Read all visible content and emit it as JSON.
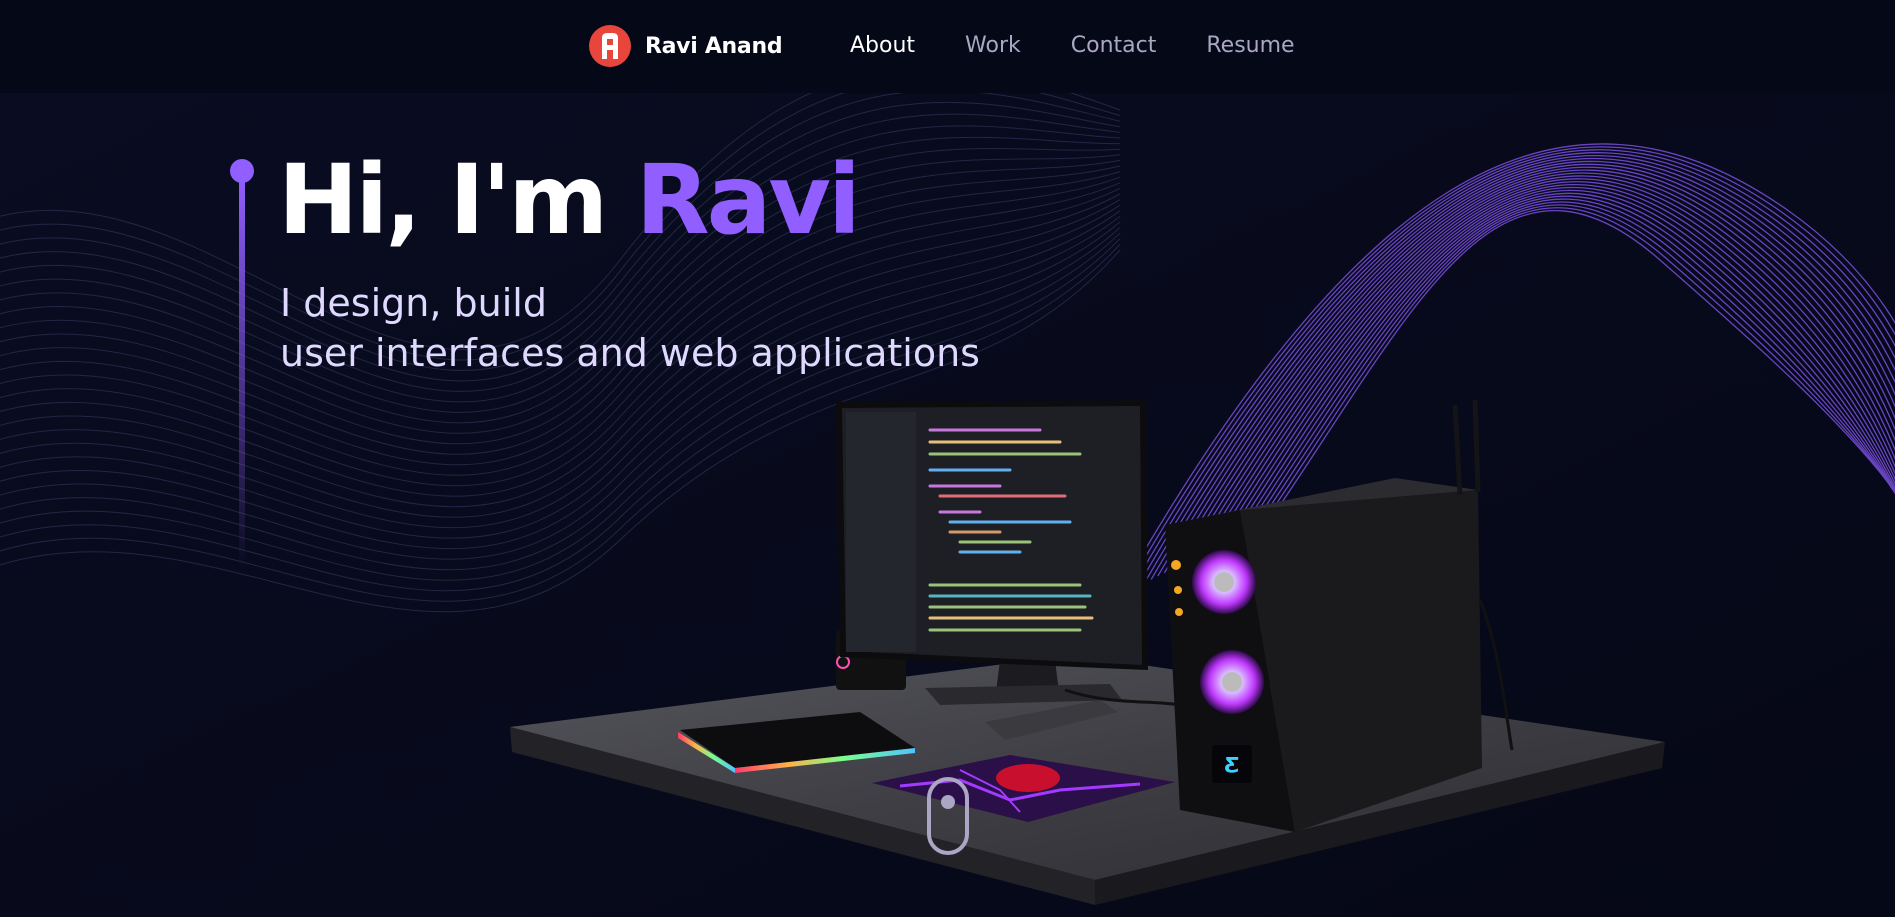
{
  "navbar": {
    "logo_icon": "brand-logo-icon",
    "brand_name": "Ravi Anand",
    "links": [
      {
        "label": "About",
        "active": true
      },
      {
        "label": "Work",
        "active": false
      },
      {
        "label": "Contact",
        "active": false
      },
      {
        "label": "Resume",
        "active": false
      }
    ]
  },
  "hero": {
    "greeting": "Hi, I'm ",
    "name": "Ravi",
    "subtitle_line1": "I design, build",
    "subtitle_line2": "user interfaces and web applications"
  },
  "scene": {
    "description_icon": "desktop-workstation-3d-model",
    "scroll_indicator_icon": "mouse-scroll-icon"
  },
  "colors": {
    "background": "#050816",
    "accent": "#915eff",
    "nav_inactive": "#aaa6c3",
    "logo_red": "#e8463c"
  }
}
